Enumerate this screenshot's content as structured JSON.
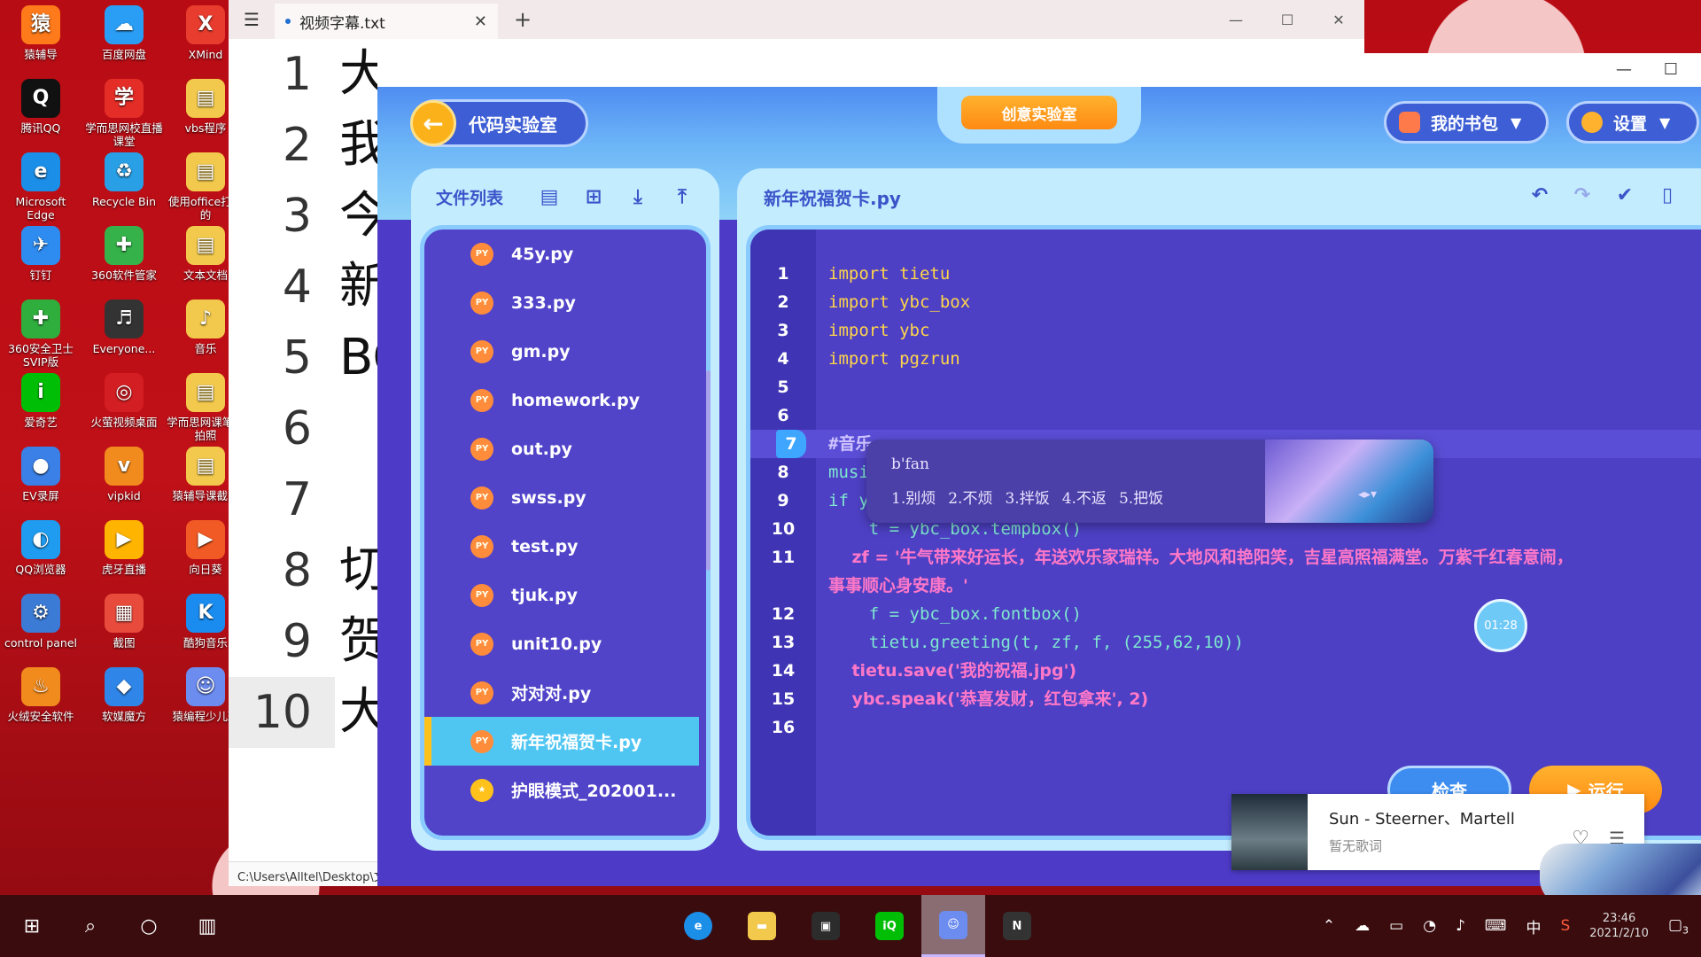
{
  "desktop": {
    "icons": [
      {
        "label": "猿辅导",
        "color": "#ff7a1a",
        "glyph": "猿"
      },
      {
        "label": "百度网盘",
        "color": "#2a9df4",
        "glyph": "☁"
      },
      {
        "label": "XMind",
        "color": "#e73c2e",
        "glyph": "X"
      },
      {
        "label": "腾讯QQ",
        "color": "#111111",
        "glyph": "Q"
      },
      {
        "label": "学而思网校直播课堂",
        "color": "#e52d27",
        "glyph": "学"
      },
      {
        "label": "vbs程序",
        "color": "#f2c94c",
        "glyph": "▤"
      },
      {
        "label": "Microsoft Edge",
        "color": "#1b8ee8",
        "glyph": "e"
      },
      {
        "label": "Recycle Bin",
        "color": "#29a0e6",
        "glyph": "♻"
      },
      {
        "label": "使用office打开的",
        "color": "#f2c94c",
        "glyph": "▤"
      },
      {
        "label": "钉钉",
        "color": "#2e8cf0",
        "glyph": "✈"
      },
      {
        "label": "360软件管家",
        "color": "#36b24a",
        "glyph": "✚"
      },
      {
        "label": "文本文档",
        "color": "#f2c94c",
        "glyph": "▤"
      },
      {
        "label": "360安全卫士SVIP版",
        "color": "#2fae3d",
        "glyph": "✚"
      },
      {
        "label": "Everyone...",
        "color": "#333333",
        "glyph": "♬"
      },
      {
        "label": "音乐",
        "color": "#f2c94c",
        "glyph": "♪"
      },
      {
        "label": "爱奇艺",
        "color": "#00be06",
        "glyph": "i"
      },
      {
        "label": "火萤视频桌面",
        "color": "#d31e23",
        "glyph": "◎"
      },
      {
        "label": "学而思网课笔记拍照",
        "color": "#f2c94c",
        "glyph": "▤"
      },
      {
        "label": "EV录屏",
        "color": "#3b80e6",
        "glyph": "●"
      },
      {
        "label": "vipkid",
        "color": "#f28b1d",
        "glyph": "v"
      },
      {
        "label": "猿辅导课截图",
        "color": "#f2c94c",
        "glyph": "▤"
      },
      {
        "label": "QQ浏览器",
        "color": "#1f9cf0",
        "glyph": "◐"
      },
      {
        "label": "虎牙直播",
        "color": "#ffb400",
        "glyph": "▶"
      },
      {
        "label": "向日葵",
        "color": "#f15a24",
        "glyph": "▶"
      },
      {
        "label": "control panel",
        "color": "#3b7bd6",
        "glyph": "⚙"
      },
      {
        "label": "截图",
        "color": "#e84b3c",
        "glyph": "▦"
      },
      {
        "label": "酷狗音乐",
        "color": "#1a8cf0",
        "glyph": "K"
      },
      {
        "label": "火绒安全软件",
        "color": "#f28b1d",
        "glyph": "♨"
      },
      {
        "label": "软媒魔方",
        "color": "#2f86e8",
        "glyph": "◆"
      },
      {
        "label": "猿编程少儿班",
        "color": "#6c8cf0",
        "glyph": "☺"
      }
    ]
  },
  "notepad": {
    "tab_title": "视频字幕.txt",
    "line_numbers": [
      "1",
      "2",
      "3",
      "4",
      "5",
      "6",
      "7",
      "8",
      "9",
      "10"
    ],
    "line_texts": [
      "大",
      "我",
      "今",
      "新",
      "BO",
      "",
      "",
      "切",
      "贺",
      "大"
    ],
    "status_path": "C:\\Users\\Alltel\\Desktop\\文"
  },
  "app": {
    "back_label": "代码实验室",
    "center_tab": "创意实验室",
    "bag_label": "我的书包",
    "settings_label": "设置",
    "file_list_title": "文件列表",
    "files": [
      {
        "name": "45y.py",
        "icon": "PY"
      },
      {
        "name": "333.py",
        "icon": "PY"
      },
      {
        "name": "gm.py",
        "icon": "PY"
      },
      {
        "name": "homework.py",
        "icon": "PY"
      },
      {
        "name": "out.py",
        "icon": "PY"
      },
      {
        "name": "swss.py",
        "icon": "PY"
      },
      {
        "name": "test.py",
        "icon": "PY"
      },
      {
        "name": "tjuk.py",
        "icon": "PY"
      },
      {
        "name": "unit10.py",
        "icon": "PY"
      },
      {
        "name": "对对对.py",
        "icon": "PY"
      },
      {
        "name": "新年祝福贺卡.py",
        "icon": "PY",
        "active": true
      },
      {
        "name": "护眼模式_202001...",
        "icon": "★"
      }
    ],
    "editor_filename": "新年祝福贺卡.py",
    "code": [
      {
        "n": "1",
        "text": "import tietu"
      },
      {
        "n": "2",
        "text": "import ybc_box"
      },
      {
        "n": "3",
        "text": "import ybc"
      },
      {
        "n": "4",
        "text": "import pgzrun"
      },
      {
        "n": "5",
        "text": ""
      },
      {
        "n": "6",
        "text": ""
      },
      {
        "n": "7",
        "text": "#音乐"
      },
      {
        "n": "8",
        "text": "music"
      },
      {
        "n": "9",
        "text": "if yb"
      },
      {
        "n": "10",
        "text": "    t = ybc_box.tempbox()"
      },
      {
        "n": "11",
        "text": "    zf = '牛气带来好运长，年送欢乐家瑞祥。大地风和艳阳笑，吉星高照福满堂。万紫千红春意闹，"
      },
      {
        "n": "",
        "text": "事事顺心身安康。'"
      },
      {
        "n": "12",
        "text": "    f = ybc_box.fontbox()"
      },
      {
        "n": "13",
        "text": "    tietu.greeting(t, zf, f, (255,62,10))"
      },
      {
        "n": "14",
        "text": "    tietu.save('我的祝福.jpg')"
      },
      {
        "n": "15",
        "text": "    ybc.speak('恭喜发财，红包拿来', 2)"
      },
      {
        "n": "16",
        "text": ""
      }
    ],
    "ime": {
      "input": "b'fan",
      "candidates": [
        "1.别烦",
        "2.不烦",
        "3.拌饭",
        "4.不返",
        "5.把饭"
      ]
    },
    "timer": "01:28",
    "check_label": "检查",
    "run_label": "运行"
  },
  "music": {
    "song": "Sun - Steerner、Martell",
    "lyrics": "暂无歌词"
  },
  "taskbar": {
    "clock_time": "23:46",
    "clock_date": "2021/2/10",
    "ime_lang": "中",
    "notification_count": "3"
  }
}
